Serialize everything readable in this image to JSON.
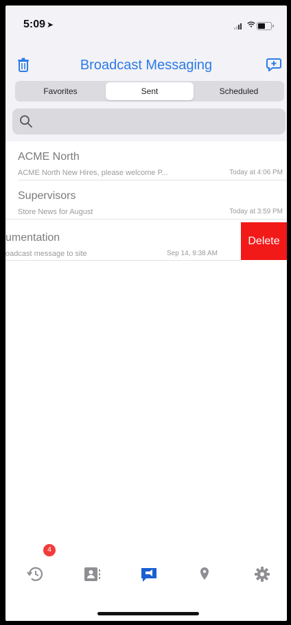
{
  "status_bar": {
    "time": "5:09"
  },
  "nav": {
    "title": "Broadcast Messaging"
  },
  "segments": [
    {
      "label": "Favorites"
    },
    {
      "label": "Sent",
      "active": true
    },
    {
      "label": "Scheduled"
    }
  ],
  "search": {
    "placeholder": ""
  },
  "messages": [
    {
      "title": "ACME North",
      "subtitle": "ACME North New Hires, please welcome P...",
      "time": "Today at 4:06 PM"
    },
    {
      "title": "Supervisors",
      "subtitle": "Store News for August",
      "time": "Today at 3:59 PM"
    },
    {
      "title": "umentation",
      "subtitle": "oadcast message to site",
      "time": "Sep 14, 9:38 AM",
      "swiped": true
    }
  ],
  "swipe_action": {
    "label": "Delete",
    "color": "#f21919"
  },
  "tab_bar": {
    "badge": "4",
    "tabs": [
      {
        "icon": "history-icon"
      },
      {
        "icon": "contacts-icon"
      },
      {
        "icon": "broadcast-icon",
        "active": true
      },
      {
        "icon": "location-pin-icon"
      },
      {
        "icon": "settings-gear-icon"
      }
    ]
  },
  "colors": {
    "accent": "#2d7be5",
    "delete": "#f21919",
    "badge": "#f23c3c"
  }
}
